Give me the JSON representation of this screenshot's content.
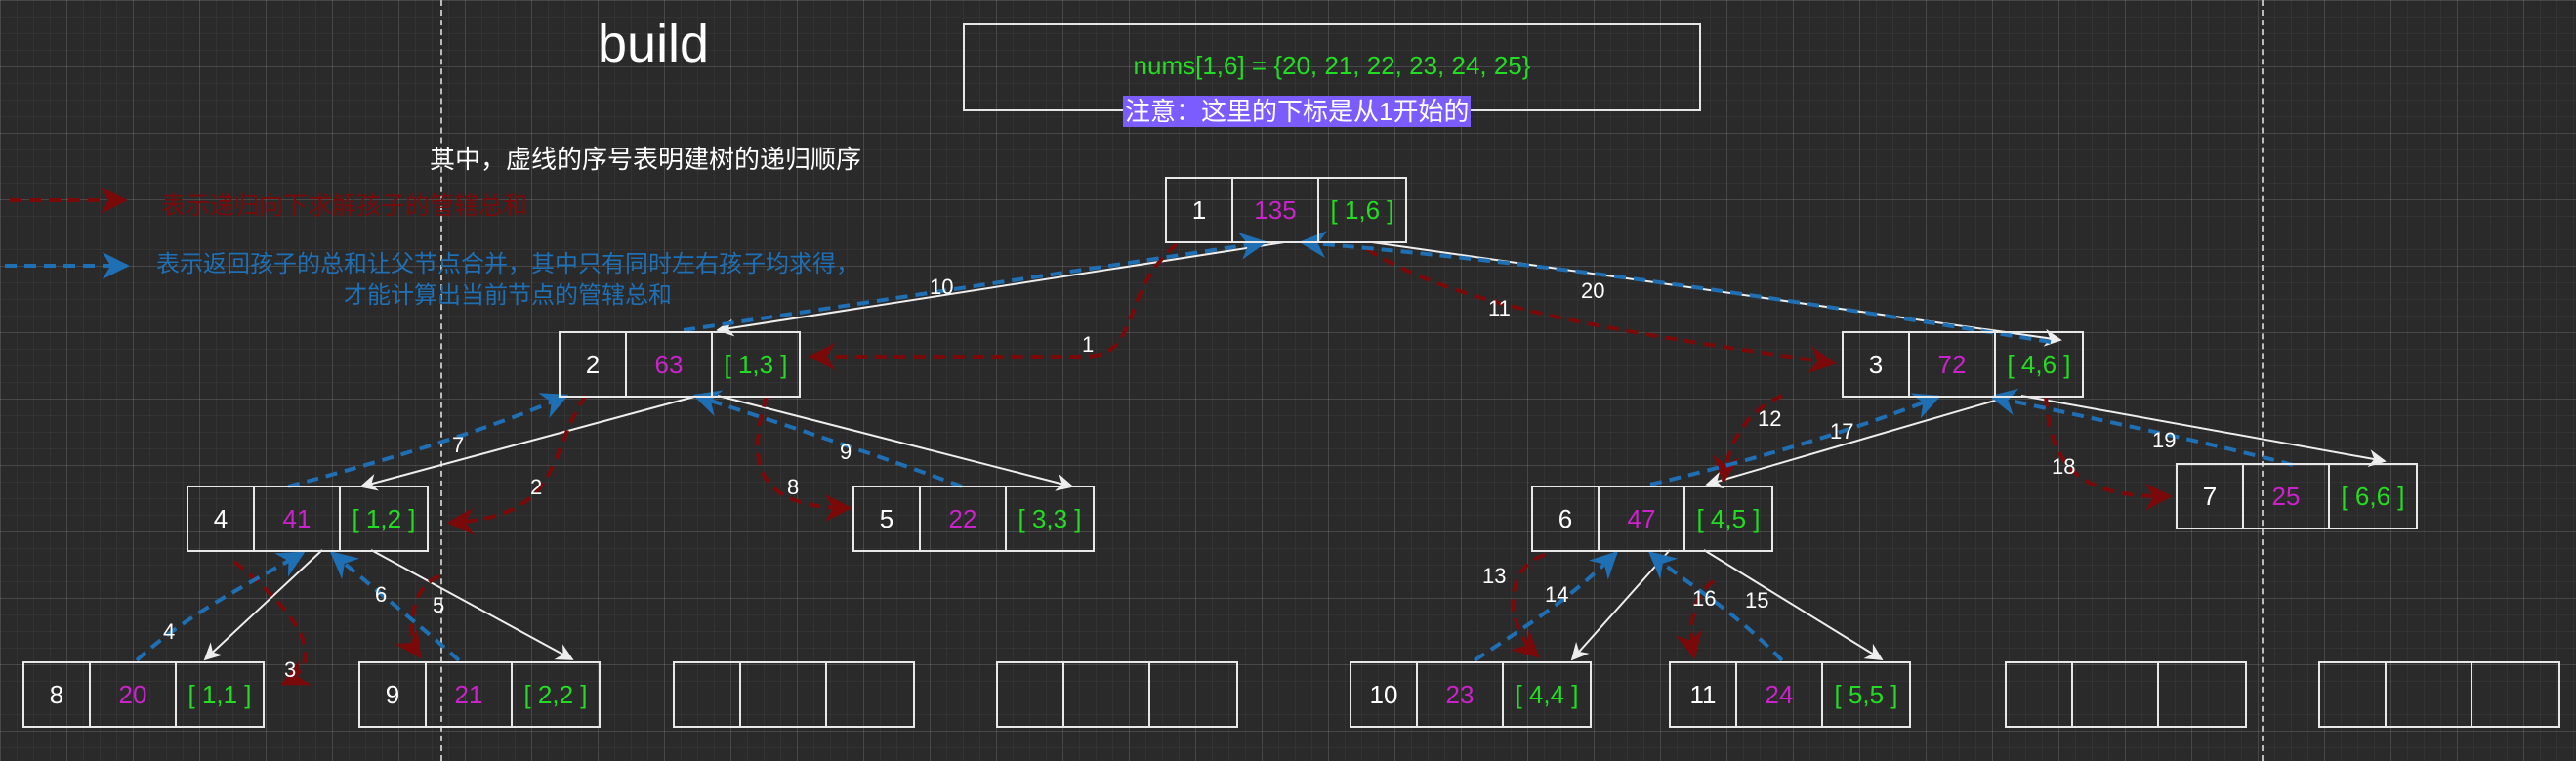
{
  "header": {
    "title": "build",
    "nums": "nums[1,6] = {20, 21, 22, 23, 24, 25}",
    "note": "注意：这里的下标是从1开始的",
    "caption": "其中，虚线的序号表明建树的递归顺序",
    "legend_red": "表示递归向下求解孩子的管辖总和",
    "legend_blue_line1": "表示返回孩子的总和让父节点合并，其中只有同时左右孩子均求得，",
    "legend_blue_line2": "才能计算出当前节点的管辖总和"
  },
  "colors": {
    "down": "#7a0a0a",
    "up": "#1f6fb5",
    "index": "#ffffff",
    "sum": "#cc22cc",
    "range": "#22dd22"
  },
  "nodes": [
    {
      "index": "1",
      "sum": "135",
      "range": "[ 1,6 ]"
    },
    {
      "index": "2",
      "sum": "63",
      "range": "[ 1,3 ]"
    },
    {
      "index": "3",
      "sum": "72",
      "range": "[ 4,6 ]"
    },
    {
      "index": "4",
      "sum": "41",
      "range": "[ 1,2 ]"
    },
    {
      "index": "5",
      "sum": "22",
      "range": "[ 3,3 ]"
    },
    {
      "index": "6",
      "sum": "47",
      "range": "[ 4,5 ]"
    },
    {
      "index": "7",
      "sum": "25",
      "range": "[ 6,6 ]"
    },
    {
      "index": "8",
      "sum": "20",
      "range": "[ 1,1 ]"
    },
    {
      "index": "9",
      "sum": "21",
      "range": "[ 2,2 ]"
    },
    {
      "index": "10",
      "sum": "23",
      "range": "[ 4,4 ]"
    },
    {
      "index": "11",
      "sum": "24",
      "range": "[ 5,5 ]"
    }
  ],
  "step_labels": [
    "1",
    "2",
    "3",
    "4",
    "5",
    "6",
    "7",
    "8",
    "9",
    "10",
    "11",
    "12",
    "13",
    "14",
    "15",
    "16",
    "17",
    "18",
    "19",
    "20"
  ]
}
